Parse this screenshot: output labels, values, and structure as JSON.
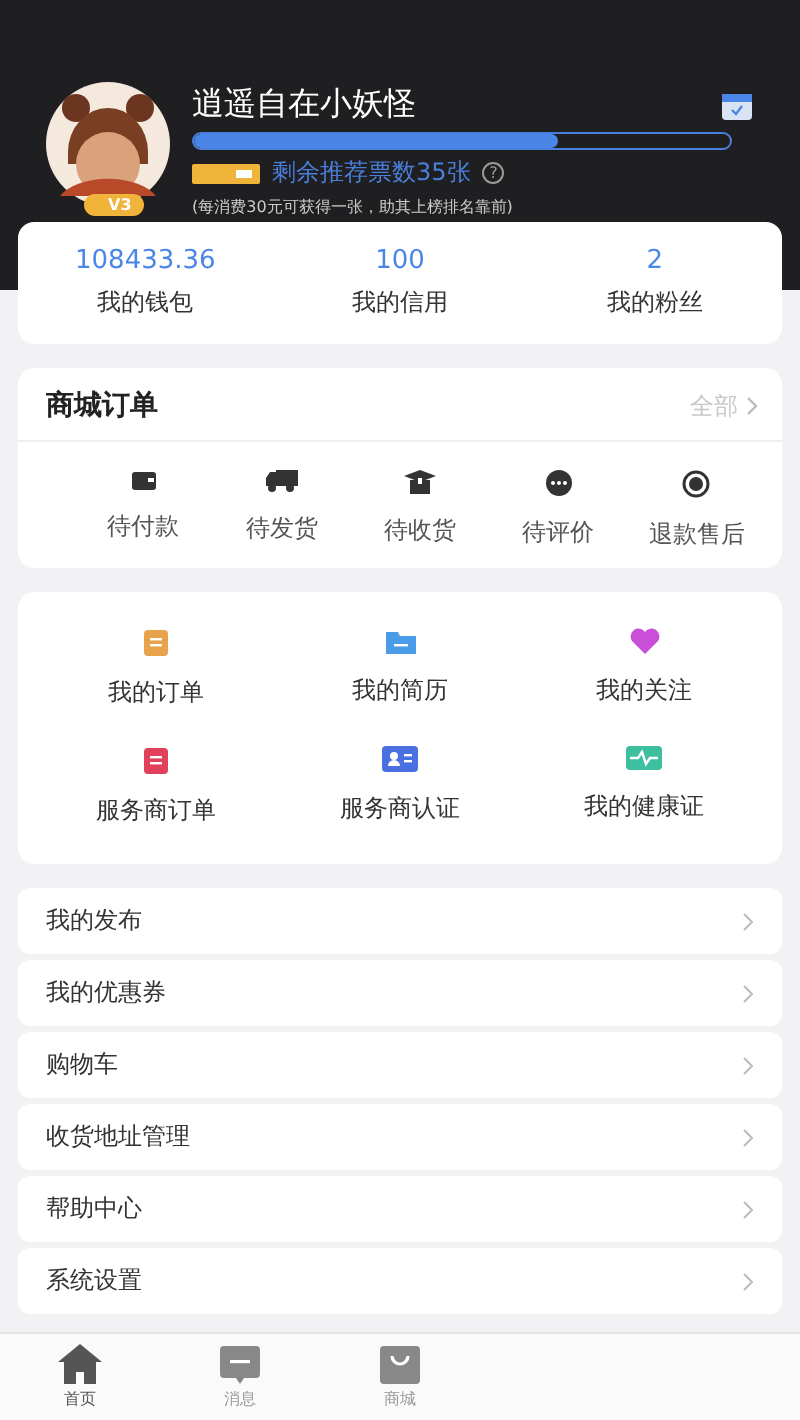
{
  "profile": {
    "name": "逍遥自在小妖怪",
    "vip_level": "V3",
    "progress": {
      "level": 0.68
    },
    "tickets": "剩余推荐票数35张",
    "help_mark": "?",
    "note": "(每消费30元可获得一张，助其上榜排名靠前)"
  },
  "stats": [
    {
      "value": "108433.36",
      "label": "我的钱包"
    },
    {
      "value": "100",
      "label": "我的信用"
    },
    {
      "value": "2",
      "label": "我的粉丝"
    }
  ],
  "orders": {
    "title": "商城订单",
    "all_link": "全部",
    "items": [
      {
        "label": "待付款",
        "kind": "wallet"
      },
      {
        "label": "待发货",
        "kind": "truck"
      },
      {
        "label": "待收货",
        "kind": "box"
      },
      {
        "label": "待评价",
        "kind": "chat"
      },
      {
        "label": "退款售后",
        "kind": "refund"
      }
    ]
  },
  "services": [
    {
      "label": "我的订单",
      "kind": "clipboard",
      "color": "#e8a24c"
    },
    {
      "label": "我的简历",
      "kind": "folder",
      "color": "#4a9be8"
    },
    {
      "label": "我的关注",
      "kind": "heart",
      "color": "#c94fd8"
    },
    {
      "label": "服务商订单",
      "kind": "clipboard",
      "color": "#e0405a"
    },
    {
      "label": "服务商认证",
      "kind": "idcard",
      "color": "#4a6fe0"
    },
    {
      "label": "我的健康证",
      "kind": "pulse",
      "color": "#3cc0a0"
    }
  ],
  "menu": [
    {
      "label": "我的发布"
    },
    {
      "label": "我的优惠券"
    },
    {
      "label": "购物车"
    },
    {
      "label": "收货地址管理"
    },
    {
      "label": "帮助中心"
    },
    {
      "label": "系统设置"
    }
  ],
  "tab_bar": [
    {
      "label": "首页",
      "kind": "home",
      "selected": true
    },
    {
      "label": "消息",
      "kind": "message",
      "selected": false
    },
    {
      "label": "商城",
      "kind": "bag",
      "selected": false
    }
  ]
}
